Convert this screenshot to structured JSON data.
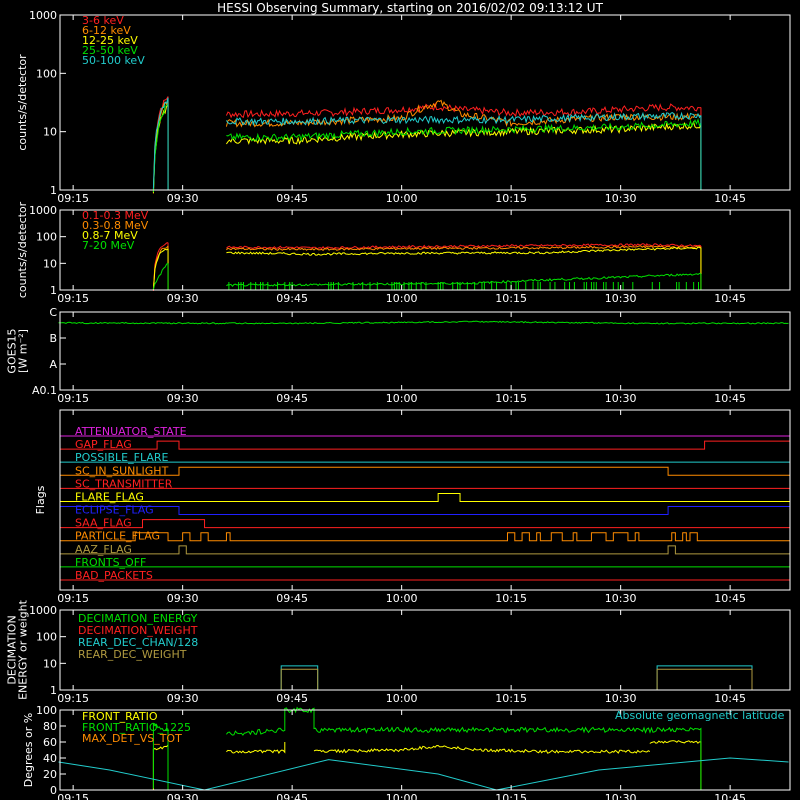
{
  "colors": {
    "red": "#ff2020",
    "orange": "#ff8c00",
    "yellow": "#ffff00",
    "green": "#00e000",
    "cyan": "#22cccc",
    "magenta": "#dd22dd",
    "blue": "#2020ff",
    "olive": "#b09a40",
    "white": "#ffffff"
  },
  "chart_data": [
    {
      "type": "line",
      "title": "HESSI Observing Summary, starting on 2016/02/02 09:13:12 UT",
      "ylabel": "counts/s/detector",
      "yscale": "log",
      "ylim": [
        1,
        1000
      ],
      "y_tick_labels": [
        "1",
        "10",
        "100",
        "1000"
      ],
      "xlim": [
        "09:13:12",
        "10:53:12"
      ],
      "x_tick_labels": [
        "09:15",
        "09:30",
        "09:45",
        "10:00",
        "10:15",
        "10:30",
        "10:45"
      ],
      "series": [
        {
          "name": "3-6 keV",
          "color": "red",
          "segments": [
            {
              "x": [
                "09:26",
                "09:27",
                "09:28"
              ],
              "y": [
                1,
                25,
                40
              ]
            },
            {
              "x": [
                "09:36",
                "09:40",
                "09:50",
                "10:00",
                "10:05",
                "10:08",
                "10:15",
                "10:25",
                "10:35",
                "10:41"
              ],
              "y": [
                20,
                20,
                21,
                24,
                27,
                24,
                21,
                22,
                26,
                26
              ]
            }
          ]
        },
        {
          "name": "6-12 keV",
          "color": "orange",
          "segments": [
            {
              "x": [
                "09:26",
                "09:27",
                "09:28"
              ],
              "y": [
                1,
                20,
                35
              ]
            },
            {
              "x": [
                "09:36",
                "09:45",
                "10:00",
                "10:05",
                "10:08",
                "10:15",
                "10:30",
                "10:41"
              ],
              "y": [
                14,
                14,
                17,
                32,
                20,
                14,
                18,
                18
              ]
            }
          ]
        },
        {
          "name": "12-25 keV",
          "color": "yellow",
          "segments": [
            {
              "x": [
                "09:26",
                "09:27",
                "09:28"
              ],
              "y": [
                1,
                15,
                28
              ]
            },
            {
              "x": [
                "09:36",
                "09:45",
                "10:00",
                "10:15",
                "10:30",
                "10:41"
              ],
              "y": [
                7,
                7,
                9,
                10,
                11,
                13
              ]
            }
          ]
        },
        {
          "name": "25-50 keV",
          "color": "green",
          "segments": [
            {
              "x": [
                "09:26",
                "09:27",
                "09:28"
              ],
              "y": [
                1,
                16,
                30
              ]
            },
            {
              "x": [
                "09:36",
                "09:45",
                "10:00",
                "10:15",
                "10:30",
                "10:41"
              ],
              "y": [
                8,
                8,
                10,
                11,
                12,
                14
              ]
            }
          ]
        },
        {
          "name": "50-100 keV",
          "color": "cyan",
          "segments": [
            {
              "x": [
                "09:26",
                "09:27",
                "09:28"
              ],
              "y": [
                1,
                22,
                38
              ]
            },
            {
              "x": [
                "09:36",
                "09:45",
                "10:00",
                "10:15",
                "10:30",
                "10:41"
              ],
              "y": [
                15,
                15,
                16,
                16,
                18,
                19
              ]
            }
          ]
        }
      ]
    },
    {
      "type": "line",
      "ylabel": "counts/s/detector",
      "yscale": "log",
      "ylim": [
        1,
        1000
      ],
      "y_tick_labels": [
        "1",
        "10",
        "100",
        "1000"
      ],
      "xlim": [
        "09:13:12",
        "10:53:12"
      ],
      "x_tick_labels": [
        "09:15",
        "09:30",
        "09:45",
        "10:00",
        "10:15",
        "10:30",
        "10:45"
      ],
      "series": [
        {
          "name": "0.1-0.3 MeV",
          "color": "red",
          "segments": [
            {
              "x": [
                "09:26",
                "09:27",
                "09:28"
              ],
              "y": [
                1,
                40,
                60
              ]
            },
            {
              "x": [
                "09:36",
                "09:44",
                "09:48",
                "10:00",
                "10:34",
                "10:41"
              ],
              "y": [
                40,
                40,
                38,
                42,
                50,
                45
              ]
            }
          ]
        },
        {
          "name": "0.3-0.8 MeV",
          "color": "orange",
          "segments": [
            {
              "x": [
                "09:26",
                "09:27",
                "09:28"
              ],
              "y": [
                1,
                30,
                45
              ]
            },
            {
              "x": [
                "09:36",
                "09:48",
                "10:00",
                "10:20",
                "10:34",
                "10:41"
              ],
              "y": [
                35,
                33,
                36,
                38,
                42,
                40
              ]
            }
          ]
        },
        {
          "name": "0.8-7 MeV",
          "color": "yellow",
          "segments": [
            {
              "x": [
                "09:26",
                "09:27",
                "09:28"
              ],
              "y": [
                1,
                25,
                35
              ]
            },
            {
              "x": [
                "09:36",
                "09:48",
                "10:00",
                "10:20",
                "10:30",
                "10:41"
              ],
              "y": [
                25,
                22,
                24,
                25,
                32,
                38
              ]
            }
          ]
        },
        {
          "name": "7-20 MeV",
          "color": "green",
          "segments": [
            {
              "x": [
                "09:26",
                "09:27",
                "09:28"
              ],
              "y": [
                1,
                4,
                10
              ]
            },
            {
              "x": [
                "09:36",
                "09:50",
                "10:10",
                "10:30",
                "10:41"
              ],
              "y": [
                1.5,
                1.6,
                1.8,
                3,
                4
              ]
            }
          ]
        }
      ]
    },
    {
      "type": "line",
      "ylabel": "GOES15 [W m⁻²]",
      "ylabel_lines": [
        "GOES15",
        "[W m⁻²]"
      ],
      "yscale": "log",
      "y_tick_labels": [
        "A0.1",
        "A",
        "B",
        "C"
      ],
      "xlim": [
        "09:13:12",
        "10:53:12"
      ],
      "x_tick_labels": [
        "09:15",
        "09:30",
        "09:45",
        "10:00",
        "10:15",
        "10:30",
        "10:45"
      ],
      "series": [
        {
          "color": "green",
          "x": [
            "09:13",
            "09:30",
            "09:45",
            "10:00",
            "10:10",
            "10:20",
            "10:35",
            "10:53"
          ],
          "level": [
            2.58,
            2.57,
            2.56,
            2.6,
            2.63,
            2.6,
            2.56,
            2.57
          ]
        }
      ]
    },
    {
      "type": "line",
      "ylabel": "Flags",
      "xlim": [
        "09:13:12",
        "10:53:12"
      ],
      "x_tick_labels": [
        "09:15",
        "09:30",
        "09:45",
        "10:00",
        "10:15",
        "10:30",
        "10:45"
      ],
      "flags": [
        {
          "label": "ATTENUATOR_STATE",
          "color": "magenta",
          "on": []
        },
        {
          "label": "GAP_FLAG",
          "color": "red",
          "on": [
            [
              "09:26:30",
              "09:29:30"
            ],
            [
              "10:41:30",
              "10:53:12"
            ]
          ]
        },
        {
          "label": "POSSIBLE_FLARE",
          "color": "cyan",
          "on": []
        },
        {
          "label": "SC_IN_SUNLIGHT",
          "color": "orange",
          "on": [
            [
              "09:29:30",
              "10:36:30"
            ]
          ]
        },
        {
          "label": "SC_TRANSMITTER",
          "color": "red",
          "on": []
        },
        {
          "label": "FLARE_FLAG",
          "color": "yellow",
          "on": [
            [
              "10:05:00",
              "10:08:00"
            ]
          ]
        },
        {
          "label": "ECLIPSE_FLAG",
          "color": "blue",
          "on": [
            [
              "09:13:12",
              "09:29:30"
            ],
            [
              "10:36:30",
              "10:53:12"
            ]
          ]
        },
        {
          "label": "SAA_FLAG",
          "color": "red",
          "on": [
            [
              "09:24:30",
              "09:33:00"
            ]
          ]
        },
        {
          "label": "PARTICLE_FLAG",
          "color": "orange",
          "on": [
            [
              "09:23:30",
              "09:28:00"
            ],
            [
              "09:30:00",
              "09:31:00"
            ],
            [
              "09:32:30",
              "09:33:30"
            ],
            [
              "09:36:00",
              "09:36:30"
            ],
            [
              "10:14:30",
              "10:15:30"
            ],
            [
              "10:16:30",
              "10:17:30"
            ],
            [
              "10:18:30",
              "10:19:00"
            ],
            [
              "10:20:30",
              "10:22:00"
            ],
            [
              "10:23:30",
              "10:24:00"
            ],
            [
              "10:26:00",
              "10:28:00"
            ],
            [
              "10:29:00",
              "10:31:00"
            ],
            [
              "10:32:00",
              "10:32:30"
            ],
            [
              "10:37:00",
              "10:37:30"
            ],
            [
              "10:38:30",
              "10:39:00"
            ],
            [
              "10:39:30",
              "10:40:30"
            ]
          ]
        },
        {
          "label": "AAZ_FLAG",
          "color": "olive",
          "on": [
            [
              "09:29:30",
              "09:30:30"
            ],
            [
              "10:36:30",
              "10:37:30"
            ]
          ]
        },
        {
          "label": "FRONTS_OFF",
          "color": "green",
          "on": []
        },
        {
          "label": "BAD_PACKETS",
          "color": "red",
          "on": []
        }
      ]
    },
    {
      "type": "line",
      "ylabel": "DECIMATION ENERGY or weight",
      "ylabel_lines": [
        "DECIMATION",
        "ENERGY or weight"
      ],
      "yscale": "log",
      "ylim": [
        1,
        1000
      ],
      "y_tick_labels": [
        "1",
        "10",
        "100",
        "1000"
      ],
      "xlim": [
        "09:13:12",
        "10:53:12"
      ],
      "x_tick_labels": [
        "09:15",
        "09:30",
        "09:45",
        "10:00",
        "10:15",
        "10:30",
        "10:45"
      ],
      "series": [
        {
          "name": "DECIMATION_ENERGY",
          "color": "green",
          "segments": []
        },
        {
          "name": "DECIMATION_WEIGHT",
          "color": "red",
          "segments": []
        },
        {
          "name": "REAR_DEC_CHAN/128",
          "color": "cyan",
          "segments": [
            {
              "x": [
                "09:43:30",
                "09:43:30",
                "09:48:30",
                "09:48:30"
              ],
              "y": [
                1,
                8,
                8,
                1
              ]
            },
            {
              "x": [
                "10:35:00",
                "10:35:00",
                "10:48:00",
                "10:48:00"
              ],
              "y": [
                1,
                8,
                8,
                1
              ]
            }
          ]
        },
        {
          "name": "REAR_DEC_WEIGHT",
          "color": "olive",
          "segments": [
            {
              "x": [
                "09:43:30",
                "09:43:30",
                "09:48:30",
                "09:48:30"
              ],
              "y": [
                1,
                6,
                6,
                1
              ]
            },
            {
              "x": [
                "10:35:00",
                "10:35:00",
                "10:48:00",
                "10:48:00"
              ],
              "y": [
                1,
                6,
                6,
                1
              ]
            }
          ]
        }
      ]
    },
    {
      "type": "line",
      "ylabel": "Degrees or %",
      "ylim": [
        0,
        100
      ],
      "y_tick_labels": [
        "0",
        "20",
        "40",
        "60",
        "80",
        "100"
      ],
      "xlim": [
        "09:13:12",
        "10:53:12"
      ],
      "x_tick_labels": [
        "09:15",
        "09:30",
        "09:45",
        "10:00",
        "10:15",
        "10:30",
        "10:45"
      ],
      "annotation": "Absolute geomagnetic latitude",
      "series": [
        {
          "name": "FRONT_RATIO",
          "color": "yellow",
          "segments": [
            {
              "x": [
                "09:26",
                "09:26",
                "09:28",
                "09:28"
              ],
              "y": [
                0,
                50,
                55,
                0
              ]
            },
            {
              "x": [
                "09:36",
                "09:44",
                "09:44"
              ],
              "y": [
                48,
                48,
                60
              ]
            },
            {
              "x": [
                "09:48",
                "10:00",
                "10:05",
                "10:10",
                "10:20",
                "10:34"
              ],
              "y": [
                48,
                50,
                55,
                50,
                48,
                48
              ]
            },
            {
              "x": [
                "10:34",
                "10:41",
                "10:41"
              ],
              "y": [
                60,
                60,
                0
              ]
            }
          ]
        },
        {
          "name": "FRONT_RATIO_1225",
          "color": "green",
          "segments": [
            {
              "x": [
                "09:26",
                "09:26",
                "09:28",
                "09:28"
              ],
              "y": [
                0,
                80,
                75,
                0
              ]
            },
            {
              "x": [
                "09:36",
                "09:44",
                "09:44",
                "09:48",
                "09:48",
                "10:41",
                "10:41"
              ],
              "y": [
                70,
                75,
                100,
                100,
                75,
                75,
                0
              ]
            }
          ]
        },
        {
          "name": "MAX_DET_VS_TOT",
          "color": "orange",
          "segments": []
        },
        {
          "color": "cyan",
          "x": [
            "09:13",
            "09:20",
            "09:33",
            "09:50",
            "10:05",
            "10:13",
            "10:27",
            "10:45",
            "10:53"
          ],
          "y": [
            35,
            25,
            0,
            38,
            20,
            0,
            25,
            40,
            35
          ]
        }
      ]
    }
  ]
}
